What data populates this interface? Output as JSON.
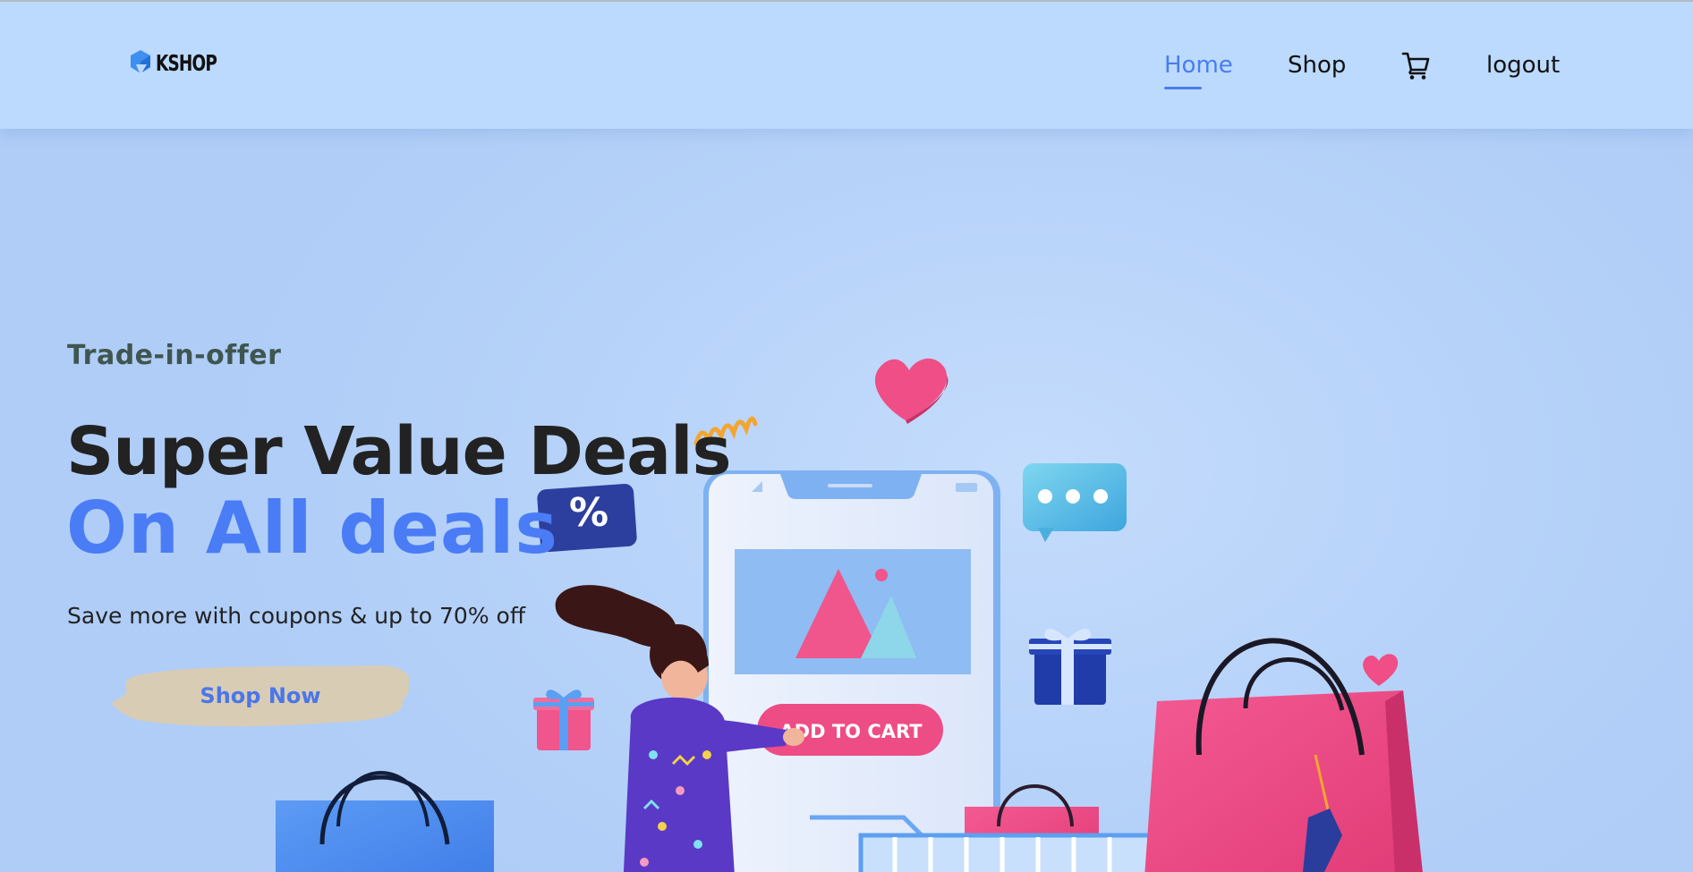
{
  "header": {
    "logo_text": "KSHOP",
    "nav": {
      "home": "Home",
      "shop": "Shop",
      "cart_icon": "shopping-cart-icon",
      "logout": "logout"
    },
    "active_nav": "Home"
  },
  "hero": {
    "promo_label": "Trade-in-offer",
    "headline_line1": "Super Value Deals",
    "headline_line2": "On All deals",
    "subtitle": "Save more with coupons & up to 70% off",
    "cta_label": "Shop Now"
  },
  "illustration": {
    "phone_button_label": "ADD TO CART",
    "discount_badge_label": "%"
  },
  "colors": {
    "accent": "#4a7cf0",
    "background": "#b9d6fb",
    "pink": "#ef4f86",
    "cta_brush": "#d8ccb5"
  }
}
